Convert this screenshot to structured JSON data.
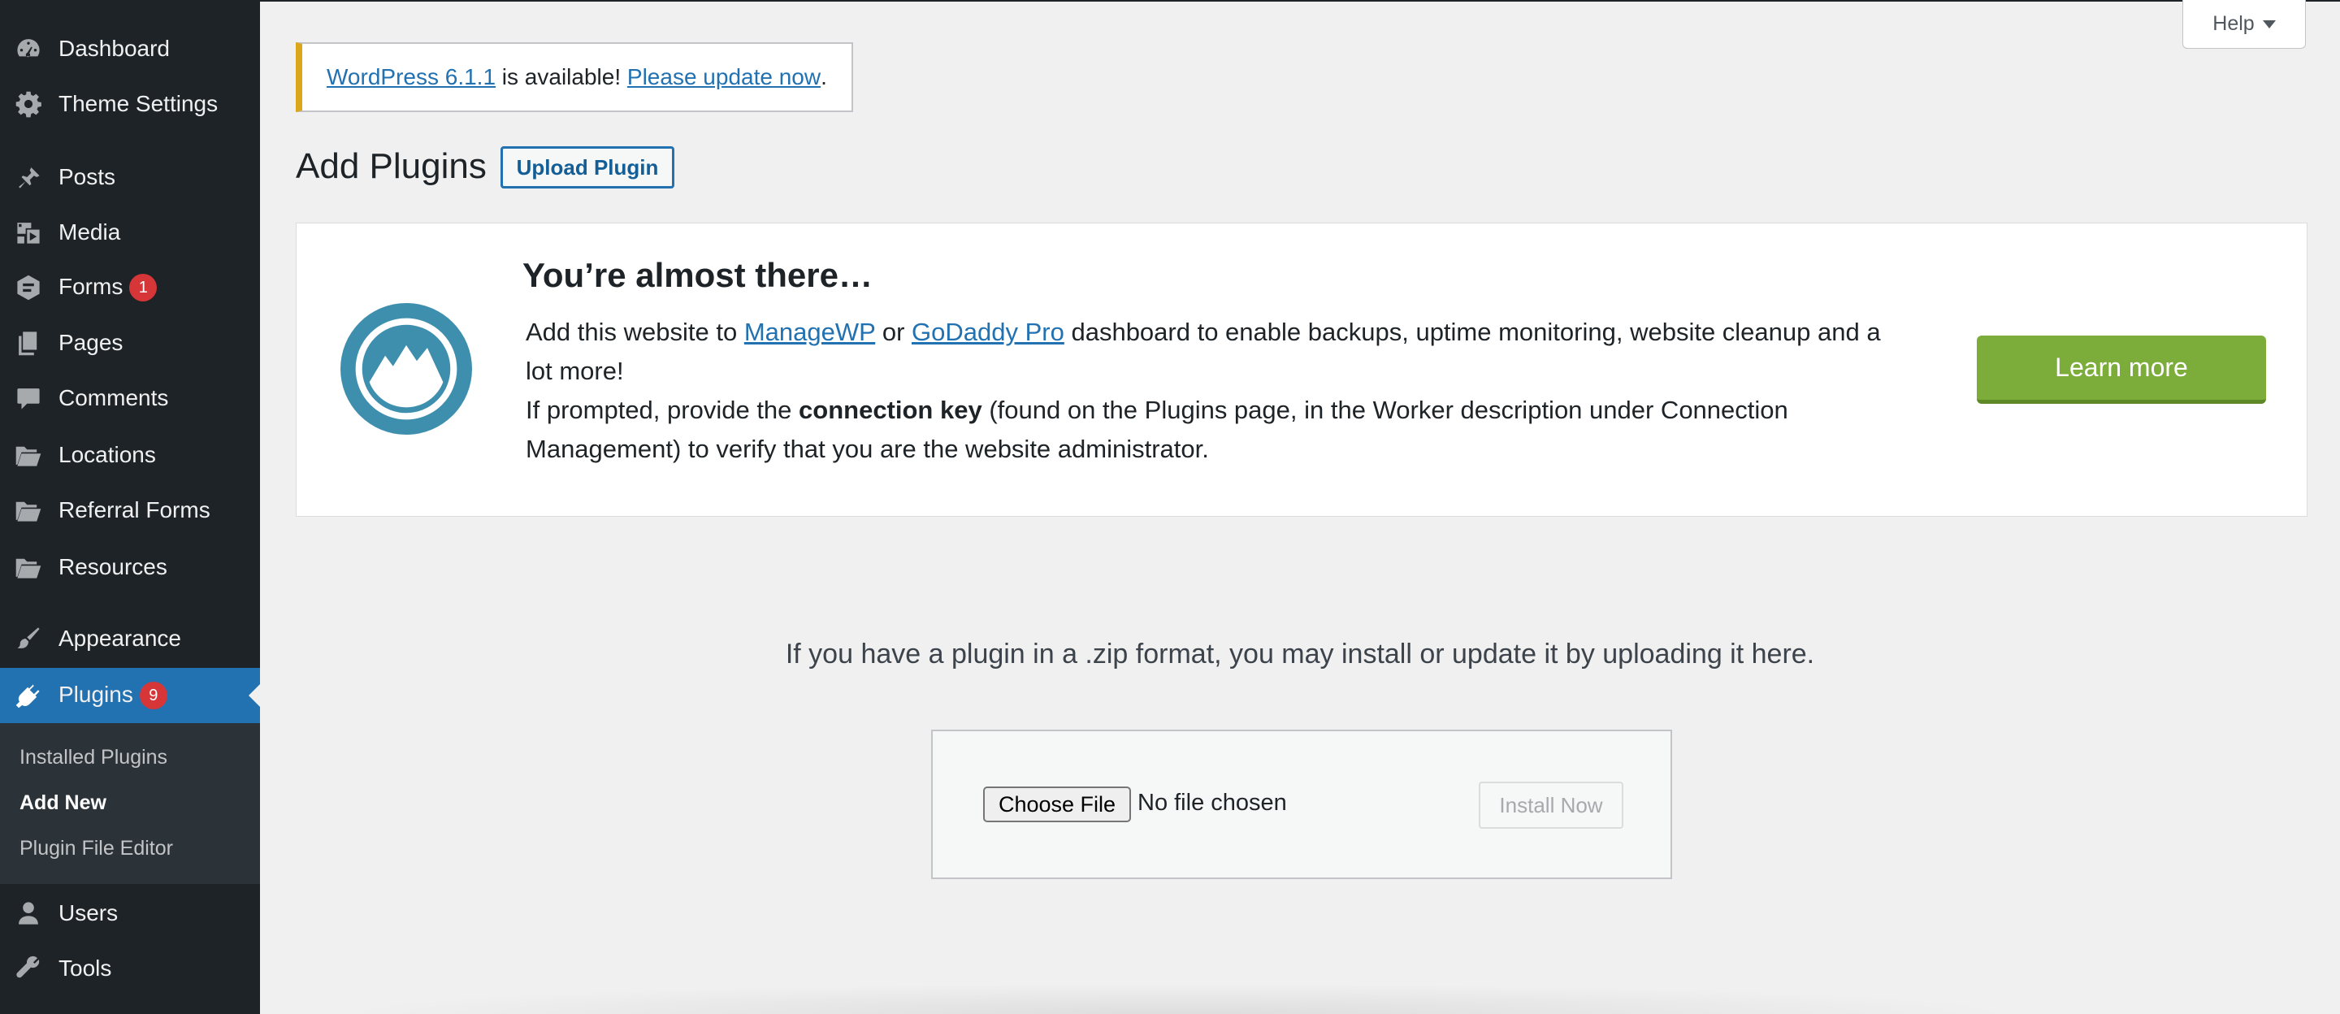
{
  "sidebar": {
    "items": [
      {
        "label": "Dashboard",
        "icon": "dashboard-icon"
      },
      {
        "label": "Theme Settings",
        "icon": "gear-icon"
      },
      {
        "label": "Posts",
        "icon": "pushpin-icon"
      },
      {
        "label": "Media",
        "icon": "media-icon"
      },
      {
        "label": "Forms",
        "icon": "forms-icon",
        "badge": "1"
      },
      {
        "label": "Pages",
        "icon": "pages-icon"
      },
      {
        "label": "Comments",
        "icon": "comment-icon"
      },
      {
        "label": "Locations",
        "icon": "folder-icon"
      },
      {
        "label": "Referral Forms",
        "icon": "folder-icon"
      },
      {
        "label": "Resources",
        "icon": "folder-icon"
      },
      {
        "label": "Appearance",
        "icon": "paintbrush-icon"
      },
      {
        "label": "Plugins",
        "icon": "plugin-icon",
        "badge": "9",
        "current": true
      },
      {
        "label": "Users",
        "icon": "user-icon"
      },
      {
        "label": "Tools",
        "icon": "wrench-icon"
      }
    ],
    "submenu": [
      {
        "label": "Installed Plugins"
      },
      {
        "label": "Add New",
        "current": true
      },
      {
        "label": "Plugin File Editor"
      }
    ]
  },
  "header": {
    "help_label": "Help"
  },
  "notice": {
    "version_link": "WordPress 6.1.1",
    "middle_text": " is available! ",
    "update_link": "Please update now",
    "end_text": "."
  },
  "page": {
    "title": "Add Plugins",
    "upload_button": "Upload Plugin"
  },
  "promo": {
    "title": "You’re almost there…",
    "line1_a": "Add this website to ",
    "link1": "ManageWP",
    "line1_b": " or ",
    "link2": "GoDaddy Pro",
    "line1_c": " dashboard to enable backups, uptime monitoring, website cleanup and a lot more!",
    "line2_a": "If prompted, provide the ",
    "line2_bold": "connection key",
    "line2_b": " (found on the Plugins page, in the Worker description under Connection Management) to verify that you are the website administrator.",
    "button": "Learn more"
  },
  "upload": {
    "hint": "If you have a plugin in a .zip format, you may install or update it by uploading it here.",
    "choose_file": "Choose File",
    "file_status": "No file chosen",
    "install_button": "Install Now"
  },
  "colors": {
    "sidebar_bg": "#1d2327",
    "accent": "#2271b1",
    "notice_warning": "#dba617",
    "badge": "#d63638",
    "learn_more": "#7cac3a",
    "promo_logo": "#3e8fae"
  }
}
